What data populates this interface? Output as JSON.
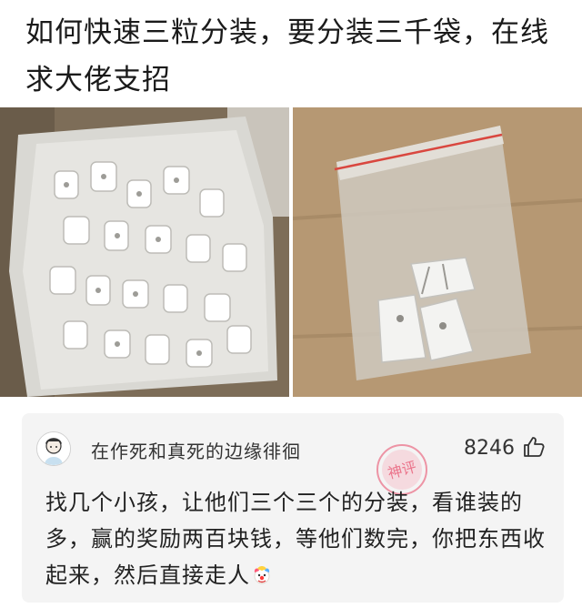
{
  "post": {
    "title": "如何快速三粒分装，要分装三千袋，在线求大佬支招"
  },
  "images": [
    {
      "name": "bulk-bag-photo",
      "subject": "large bag of white plastic hooks"
    },
    {
      "name": "small-bag-photo",
      "subject": "small zip bag with three white plastic hooks"
    }
  ],
  "comment": {
    "username": "在作死和真死的边缘徘徊",
    "likes": "8246",
    "badge_text": "神评",
    "text": "找几个小孩，让他们三个三个的分装，看谁装的多，赢的奖励两百块钱，等他们数完，你把东西收起来，然后直接走人",
    "trailing_emoji": "clown-emoji"
  },
  "colors": {
    "comment_bg": "#f4f4f4",
    "stamp": "#e8536f",
    "text": "#222222"
  }
}
